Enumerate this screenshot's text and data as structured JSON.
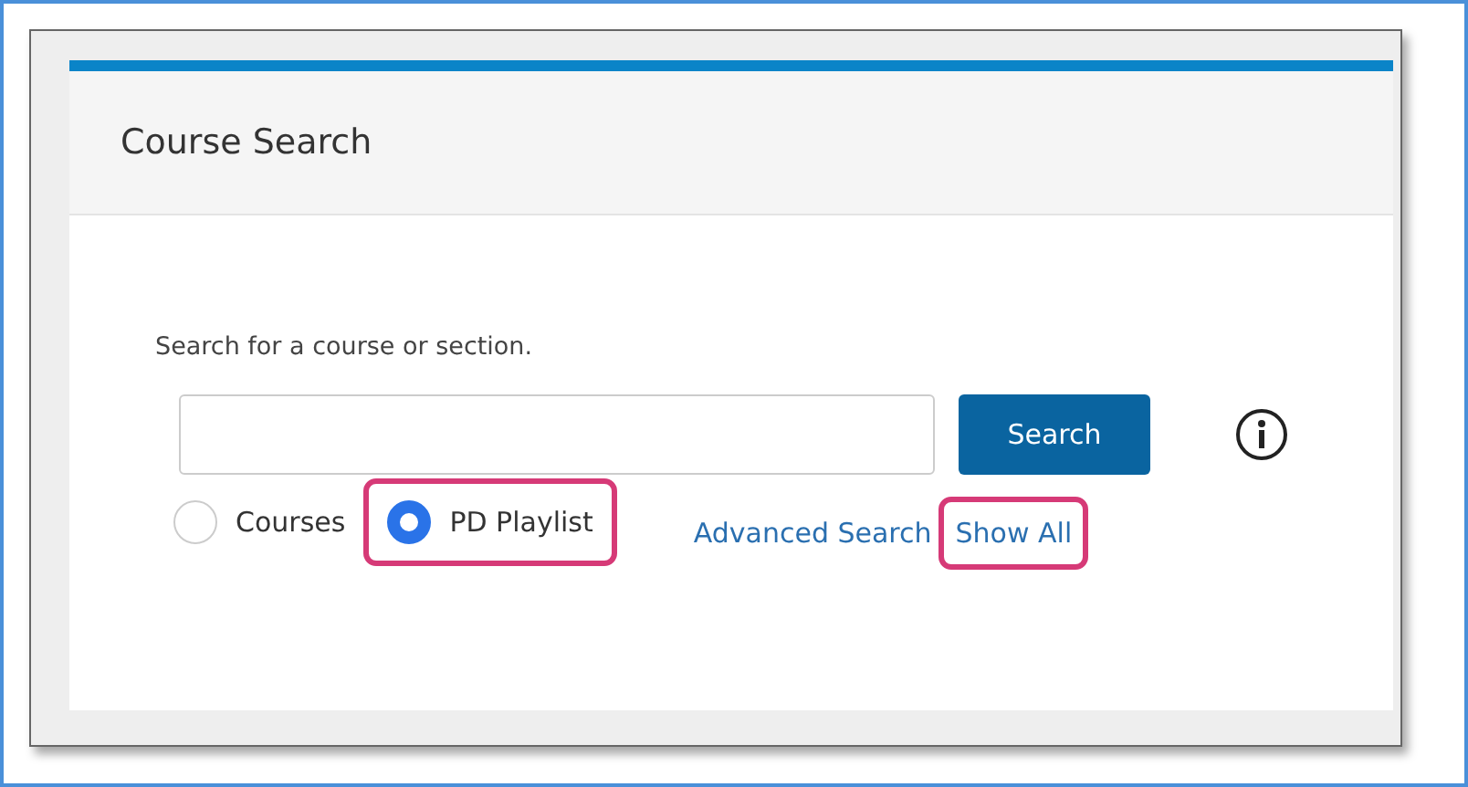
{
  "panel": {
    "title": "Course Search"
  },
  "search": {
    "description": "Search for a course or section.",
    "button": "Search"
  },
  "scope_options": [
    {
      "label": "Courses",
      "selected": false,
      "highlighted": false
    },
    {
      "label": "PD Playlist",
      "selected": true,
      "highlighted": true
    }
  ],
  "links": [
    {
      "label": "Advanced Search",
      "highlighted": false
    },
    {
      "label": "Show All",
      "highlighted": true
    }
  ]
}
